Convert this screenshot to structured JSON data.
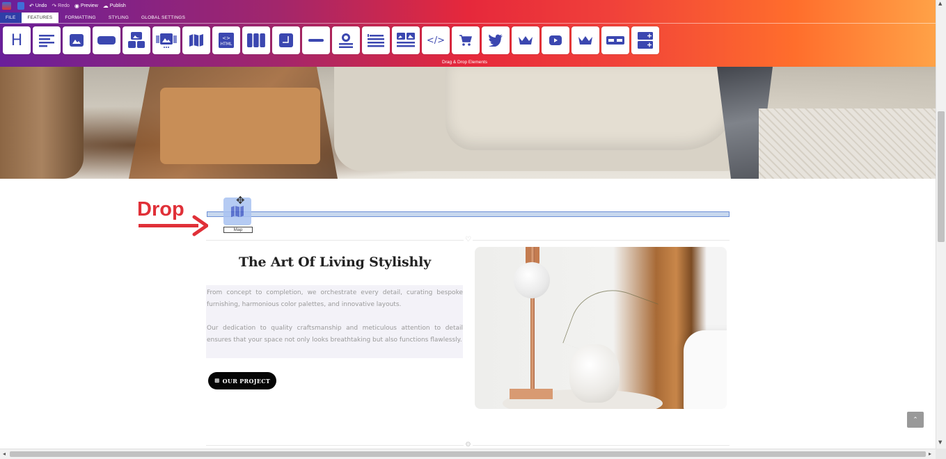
{
  "quickbar": {
    "undo": "Undo",
    "redo": "Redo",
    "preview": "Preview",
    "publish": "Publish"
  },
  "menu": {
    "tabs": [
      {
        "label": "FILE"
      },
      {
        "label": "FEATURES"
      },
      {
        "label": "FORMATTING"
      },
      {
        "label": "STYLING"
      },
      {
        "label": "GLOBAL SETTINGS"
      }
    ],
    "active_tab": "FEATURES"
  },
  "toolstrip": {
    "label": "Drag & Drop Elements",
    "tools": [
      {
        "name": "heading",
        "glyph": "H"
      },
      {
        "name": "text",
        "glyph": "≡"
      },
      {
        "name": "image",
        "glyph": "▲"
      },
      {
        "name": "button",
        "glyph": "▬"
      },
      {
        "name": "image-gallery",
        "glyph": "▦"
      },
      {
        "name": "image-slider",
        "glyph": "▣"
      },
      {
        "name": "map",
        "glyph": "◫"
      },
      {
        "name": "html",
        "glyph": "HTML"
      },
      {
        "name": "columns",
        "glyph": "▥"
      },
      {
        "name": "box",
        "glyph": "◲"
      },
      {
        "name": "divider",
        "glyph": "—"
      },
      {
        "name": "profile",
        "glyph": "◉"
      },
      {
        "name": "list",
        "glyph": "☰"
      },
      {
        "name": "media-text",
        "glyph": "▤"
      },
      {
        "name": "code",
        "glyph": "</>"
      },
      {
        "name": "cart",
        "glyph": "🛒"
      },
      {
        "name": "twitter",
        "glyph": "🐦"
      },
      {
        "name": "premium",
        "glyph": "♛"
      },
      {
        "name": "youtube",
        "glyph": "▶"
      },
      {
        "name": "premium-2",
        "glyph": "♛"
      },
      {
        "name": "button-group",
        "glyph": "▭▭"
      },
      {
        "name": "add-section",
        "glyph": "⊞"
      }
    ]
  },
  "drop": {
    "label": "Drop",
    "drag_tag": "Map"
  },
  "content": {
    "title": "The Art Of Living Stylishly",
    "paragraph_1": "From concept to completion, we orchestrate every detail, curating bespoke furnishing, harmonious color palettes, and innovative layouts.",
    "paragraph_2": "Our dedication to quality craftsmanship and meticulous attention to detail ensures that your space not only looks breathtaking but also functions flawlessly.",
    "button": "OUR PROJECT"
  },
  "colors": {
    "accent_red": "#e03038",
    "tool_icon": "#3b47b0"
  }
}
